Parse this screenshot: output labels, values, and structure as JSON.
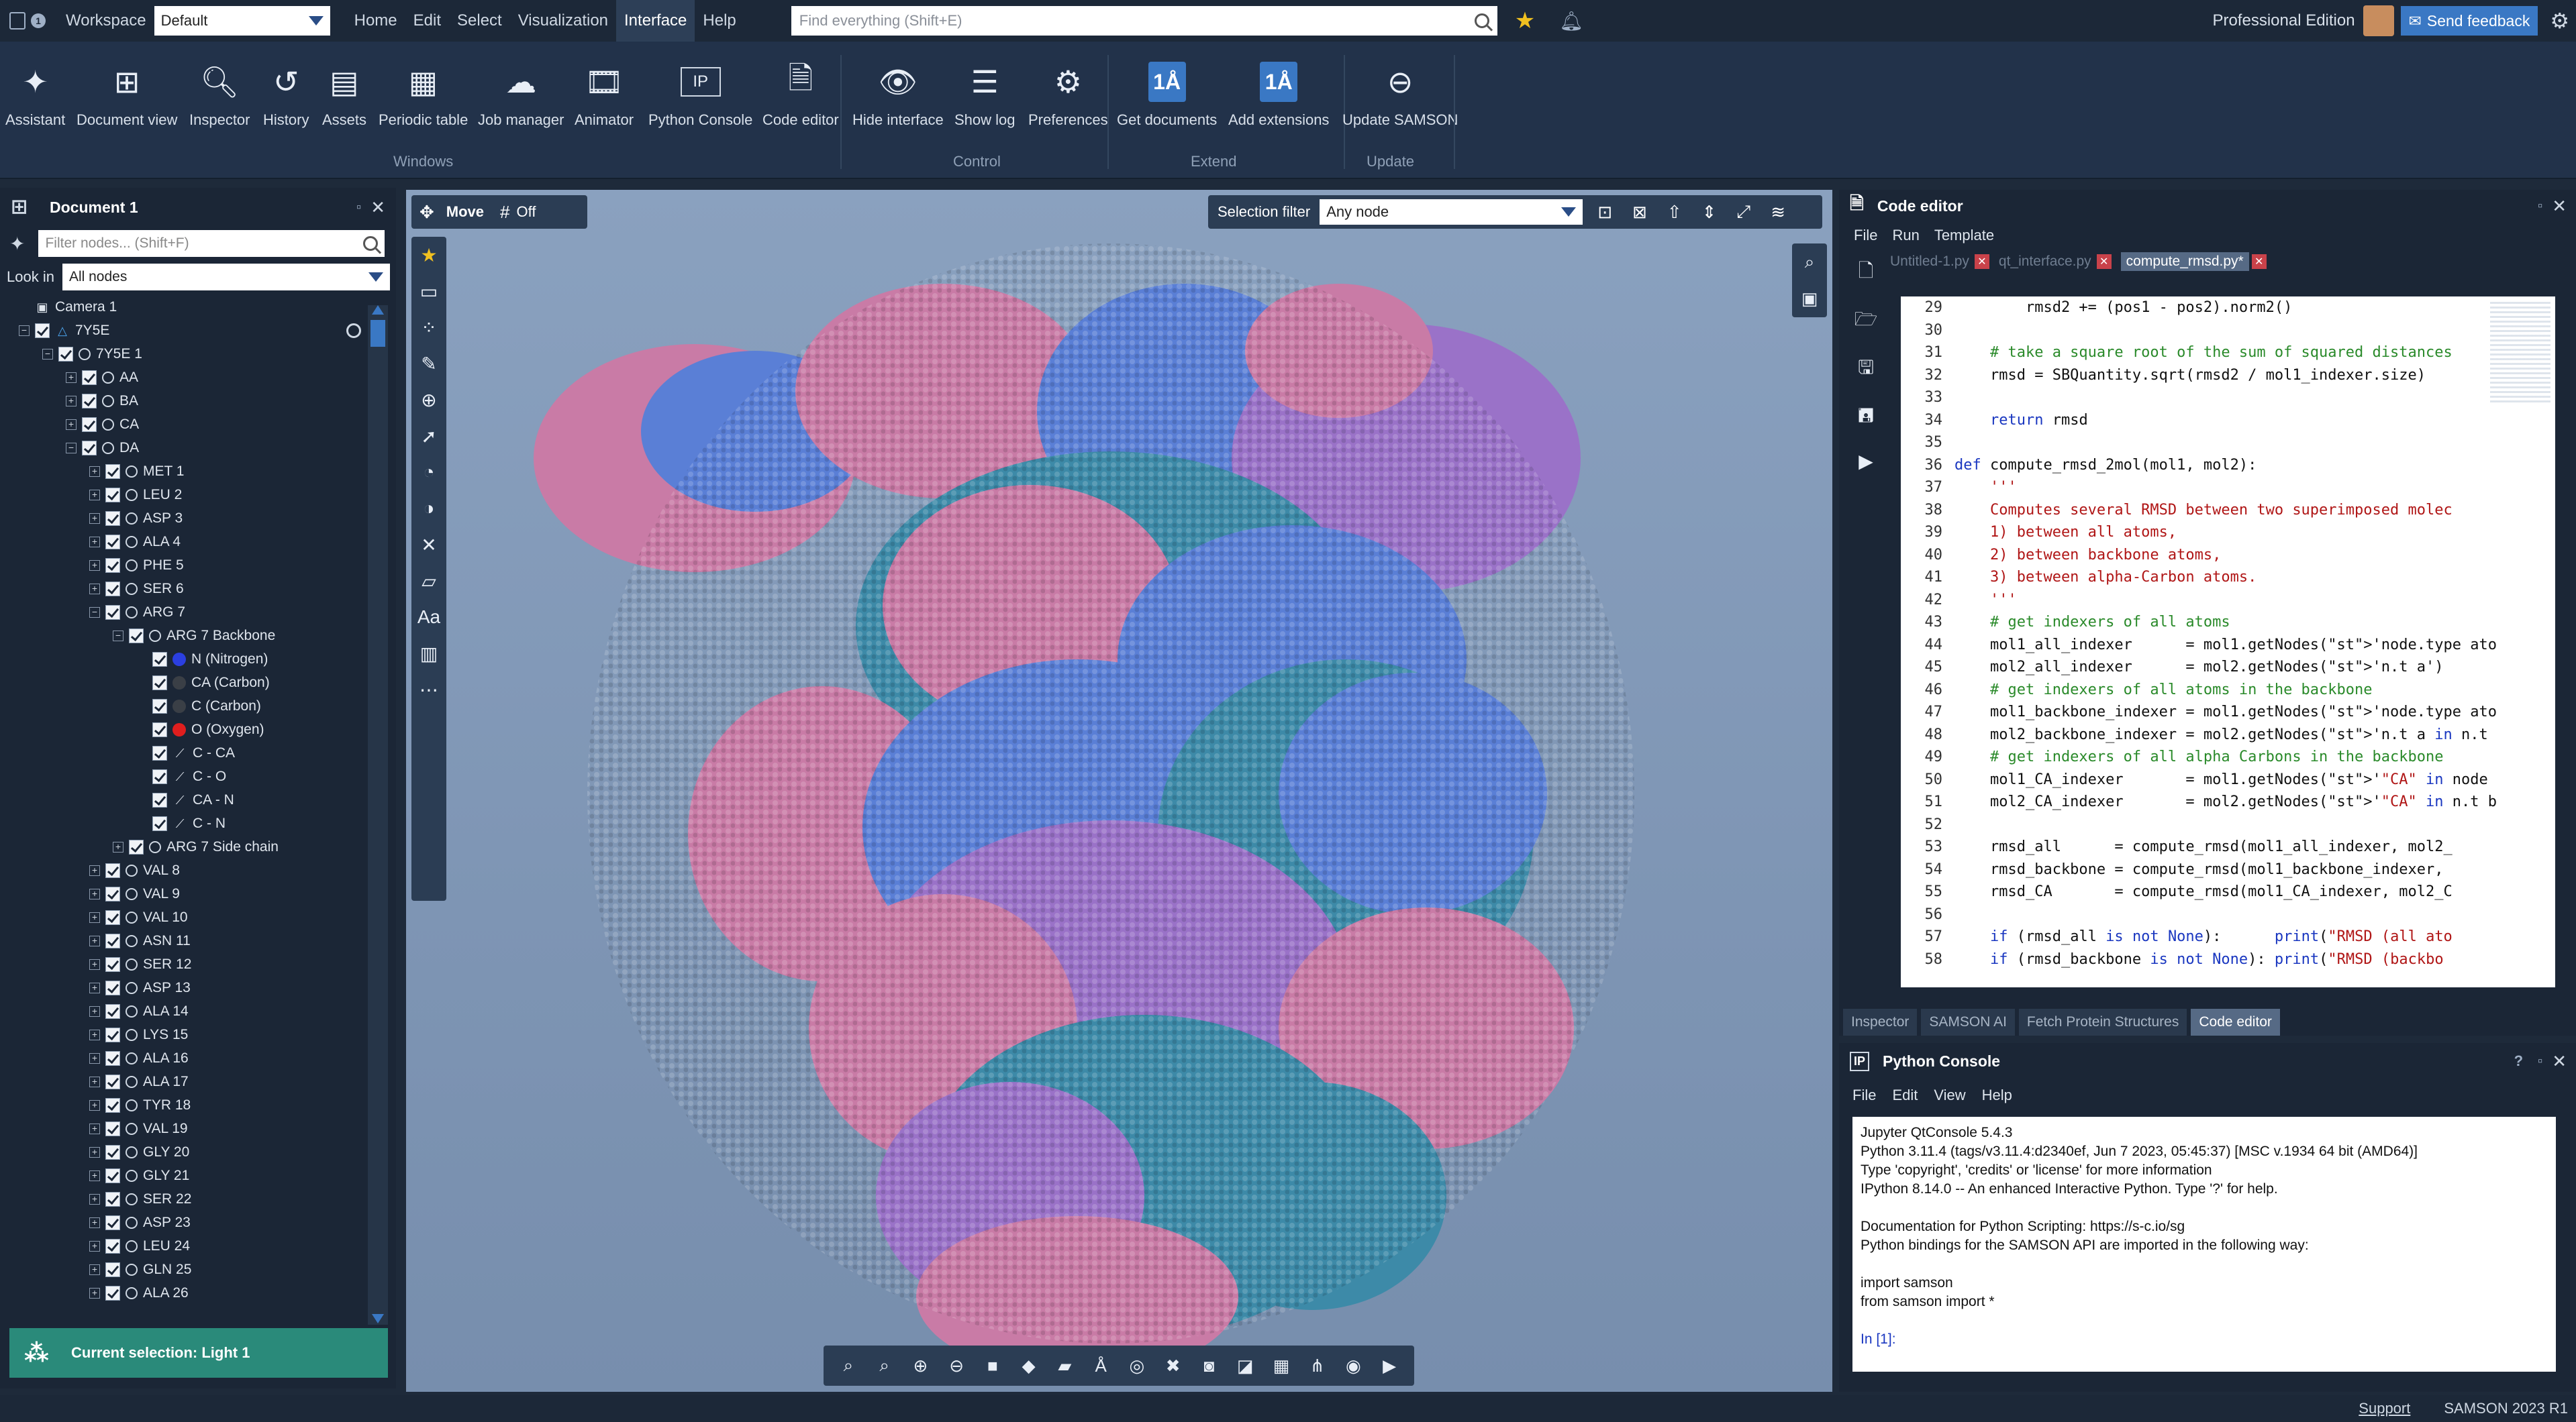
{
  "menubar": {
    "workspace_label": "Workspace",
    "workspace_value": "Default",
    "menus": [
      "Home",
      "Edit",
      "Select",
      "Visualization",
      "Interface",
      "Help"
    ],
    "active_menu": "Interface",
    "search_placeholder": "Find everything (Shift+E)",
    "edition": "Professional Edition",
    "feedback": "Send feedback"
  },
  "ribbon": {
    "buttons": [
      "Assistant",
      "Document view",
      "Inspector",
      "History",
      "Assets",
      "Periodic table",
      "Job manager",
      "Animator",
      "Python Console",
      "Code editor",
      "Hide interface",
      "Show log",
      "Preferences",
      "Get documents",
      "Add extensions",
      "Update SAMSON"
    ],
    "groups": [
      "Windows",
      "Control",
      "Extend",
      "Update"
    ],
    "badge_text": "1Å"
  },
  "document": {
    "title": "Document 1",
    "filter_placeholder": "Filter nodes... (Shift+F)",
    "lookin_label": "Look in",
    "lookin_value": "All nodes",
    "tree": [
      {
        "label": "Camera 1",
        "indent": 0,
        "exp": "",
        "chk": false,
        "icon": "camera"
      },
      {
        "label": "7Y5E",
        "indent": 0,
        "exp": "−",
        "chk": true,
        "icon": "doc"
      },
      {
        "label": "7Y5E 1",
        "indent": 1,
        "exp": "−",
        "chk": true,
        "icon": "gear"
      },
      {
        "label": "AA",
        "indent": 2,
        "exp": "+",
        "chk": true,
        "icon": "gear"
      },
      {
        "label": "BA",
        "indent": 2,
        "exp": "+",
        "chk": true,
        "icon": "gear"
      },
      {
        "label": "CA",
        "indent": 2,
        "exp": "+",
        "chk": true,
        "icon": "gear"
      },
      {
        "label": "DA",
        "indent": 2,
        "exp": "−",
        "chk": true,
        "icon": "gear"
      },
      {
        "label": "MET 1",
        "indent": 3,
        "exp": "+",
        "chk": true,
        "icon": "gear"
      },
      {
        "label": "LEU 2",
        "indent": 3,
        "exp": "+",
        "chk": true,
        "icon": "gear"
      },
      {
        "label": "ASP 3",
        "indent": 3,
        "exp": "+",
        "chk": true,
        "icon": "gear"
      },
      {
        "label": "ALA 4",
        "indent": 3,
        "exp": "+",
        "chk": true,
        "icon": "gear"
      },
      {
        "label": "PHE 5",
        "indent": 3,
        "exp": "+",
        "chk": true,
        "icon": "gear"
      },
      {
        "label": "SER 6",
        "indent": 3,
        "exp": "+",
        "chk": true,
        "icon": "gear"
      },
      {
        "label": "ARG 7",
        "indent": 3,
        "exp": "−",
        "chk": true,
        "icon": "gear"
      },
      {
        "label": "ARG 7 Backbone",
        "indent": 4,
        "exp": "−",
        "chk": true,
        "icon": "gear"
      },
      {
        "label": "N (Nitrogen)",
        "indent": 5,
        "exp": "",
        "chk": true,
        "icon": "dot-n"
      },
      {
        "label": "CA (Carbon)",
        "indent": 5,
        "exp": "",
        "chk": true,
        "icon": "dot-c"
      },
      {
        "label": "C (Carbon)",
        "indent": 5,
        "exp": "",
        "chk": true,
        "icon": "dot-c"
      },
      {
        "label": "O (Oxygen)",
        "indent": 5,
        "exp": "",
        "chk": true,
        "icon": "dot-o"
      },
      {
        "label": "C - CA",
        "indent": 5,
        "exp": "",
        "chk": true,
        "icon": "bond"
      },
      {
        "label": "C - O",
        "indent": 5,
        "exp": "",
        "chk": true,
        "icon": "bond"
      },
      {
        "label": "CA - N",
        "indent": 5,
        "exp": "",
        "chk": true,
        "icon": "bond"
      },
      {
        "label": "C - N",
        "indent": 5,
        "exp": "",
        "chk": true,
        "icon": "bond"
      },
      {
        "label": "ARG 7 Side chain",
        "indent": 4,
        "exp": "+",
        "chk": true,
        "icon": "gear"
      },
      {
        "label": "VAL 8",
        "indent": 3,
        "exp": "+",
        "chk": true,
        "icon": "gear"
      },
      {
        "label": "VAL 9",
        "indent": 3,
        "exp": "+",
        "chk": true,
        "icon": "gear"
      },
      {
        "label": "VAL 10",
        "indent": 3,
        "exp": "+",
        "chk": true,
        "icon": "gear"
      },
      {
        "label": "ASN 11",
        "indent": 3,
        "exp": "+",
        "chk": true,
        "icon": "gear"
      },
      {
        "label": "SER 12",
        "indent": 3,
        "exp": "+",
        "chk": true,
        "icon": "gear"
      },
      {
        "label": "ASP 13",
        "indent": 3,
        "exp": "+",
        "chk": true,
        "icon": "gear"
      },
      {
        "label": "ALA 14",
        "indent": 3,
        "exp": "+",
        "chk": true,
        "icon": "gear"
      },
      {
        "label": "LYS 15",
        "indent": 3,
        "exp": "+",
        "chk": true,
        "icon": "gear"
      },
      {
        "label": "ALA 16",
        "indent": 3,
        "exp": "+",
        "chk": true,
        "icon": "gear"
      },
      {
        "label": "ALA 17",
        "indent": 3,
        "exp": "+",
        "chk": true,
        "icon": "gear"
      },
      {
        "label": "TYR 18",
        "indent": 3,
        "exp": "+",
        "chk": true,
        "icon": "gear"
      },
      {
        "label": "VAL 19",
        "indent": 3,
        "exp": "+",
        "chk": true,
        "icon": "gear"
      },
      {
        "label": "GLY 20",
        "indent": 3,
        "exp": "+",
        "chk": true,
        "icon": "gear"
      },
      {
        "label": "GLY 21",
        "indent": 3,
        "exp": "+",
        "chk": true,
        "icon": "gear"
      },
      {
        "label": "SER 22",
        "indent": 3,
        "exp": "+",
        "chk": true,
        "icon": "gear"
      },
      {
        "label": "ASP 23",
        "indent": 3,
        "exp": "+",
        "chk": true,
        "icon": "gear"
      },
      {
        "label": "LEU 24",
        "indent": 3,
        "exp": "+",
        "chk": true,
        "icon": "gear"
      },
      {
        "label": "GLN 25",
        "indent": 3,
        "exp": "+",
        "chk": true,
        "icon": "gear"
      },
      {
        "label": "ALA 26",
        "indent": 3,
        "exp": "+",
        "chk": true,
        "icon": "gear"
      }
    ],
    "current_selection": "Current selection: Light 1"
  },
  "viewport": {
    "move_label": "Move",
    "snap_label": "Off",
    "selection_filter_label": "Selection filter",
    "selection_filter_value": "Any node"
  },
  "code_editor": {
    "title": "Code editor",
    "menus": [
      "File",
      "Run",
      "Template"
    ],
    "tabs": [
      "Untitled-1.py",
      "qt_interface.py",
      "compute_rmsd.py*"
    ],
    "active_tab": "compute_rmsd.py*",
    "lines": [
      {
        "n": "29",
        "code": "        rmsd2 += (pos1 - pos2).norm2()"
      },
      {
        "n": "30",
        "code": ""
      },
      {
        "n": "31",
        "code": "    # take a square root of the sum of squared distances"
      },
      {
        "n": "32",
        "code": "    rmsd = SBQuantity.sqrt(rmsd2 / mol1_indexer.size)"
      },
      {
        "n": "33",
        "code": ""
      },
      {
        "n": "34",
        "code": "    return rmsd"
      },
      {
        "n": "35",
        "code": ""
      },
      {
        "n": "36",
        "code": "def compute_rmsd_2mol(mol1, mol2):"
      },
      {
        "n": "37",
        "code": "    '''"
      },
      {
        "n": "38",
        "code": "    Computes several RMSD between two superimposed molec"
      },
      {
        "n": "39",
        "code": "    1) between all atoms,"
      },
      {
        "n": "40",
        "code": "    2) between backbone atoms,"
      },
      {
        "n": "41",
        "code": "    3) between alpha-Carbon atoms."
      },
      {
        "n": "42",
        "code": "    '''"
      },
      {
        "n": "43",
        "code": "    # get indexers of all atoms"
      },
      {
        "n": "44",
        "code": "    mol1_all_indexer      = mol1.getNodes('node.type ato"
      },
      {
        "n": "45",
        "code": "    mol2_all_indexer      = mol2.getNodes('n.t a')"
      },
      {
        "n": "46",
        "code": "    # get indexers of all atoms in the backbone"
      },
      {
        "n": "47",
        "code": "    mol1_backbone_indexer = mol1.getNodes('node.type ato"
      },
      {
        "n": "48",
        "code": "    mol2_backbone_indexer = mol2.getNodes('n.t a in n.t"
      },
      {
        "n": "49",
        "code": "    # get indexers of all alpha Carbons in the backbone"
      },
      {
        "n": "50",
        "code": "    mol1_CA_indexer       = mol1.getNodes('\"CA\" in node"
      },
      {
        "n": "51",
        "code": "    mol2_CA_indexer       = mol2.getNodes('\"CA\" in n.t b"
      },
      {
        "n": "52",
        "code": ""
      },
      {
        "n": "53",
        "code": "    rmsd_all      = compute_rmsd(mol1_all_indexer, mol2_"
      },
      {
        "n": "54",
        "code": "    rmsd_backbone = compute_rmsd(mol1_backbone_indexer,"
      },
      {
        "n": "55",
        "code": "    rmsd_CA       = compute_rmsd(mol1_CA_indexer, mol2_C"
      },
      {
        "n": "56",
        "code": ""
      },
      {
        "n": "57",
        "code": "    if (rmsd_all is not None):      print(\"RMSD (all ato"
      },
      {
        "n": "58",
        "code": "    if (rmsd_backbone is not None): print(\"RMSD (backbo"
      }
    ]
  },
  "panel_tabs": [
    "Inspector",
    "SAMSON AI",
    "Fetch Protein Structures",
    "Code editor"
  ],
  "active_panel_tab": "Code editor",
  "python_console": {
    "title": "Python Console",
    "menus": [
      "File",
      "Edit",
      "View",
      "Help"
    ],
    "lines": [
      "Jupyter QtConsole 5.4.3",
      "Python 3.11.4 (tags/v3.11.4:d2340ef, Jun  7 2023, 05:45:37) [MSC v.1934 64 bit (AMD64)]",
      "Type 'copyright', 'credits' or 'license' for more information",
      "IPython 8.14.0 -- An enhanced Interactive Python. Type '?' for help.",
      "",
      "Documentation for Python Scripting: https://s-c.io/sg",
      "Python bindings for the SAMSON API are imported in the following way:",
      "",
      "import samson",
      "from samson import *",
      ""
    ],
    "prompt": "In [1]:"
  },
  "status": {
    "support": "Support",
    "version": "SAMSON 2023 R1"
  },
  "colors": {
    "accent": "#3a78c4",
    "selection_bar": "#2a8a7a",
    "viewport_bg": "#8aa1bf",
    "molecule_pink": "#c97ba6",
    "molecule_blue": "#5a7fd6",
    "molecule_teal": "#3d8aa8",
    "molecule_violet": "#9a72c8"
  }
}
